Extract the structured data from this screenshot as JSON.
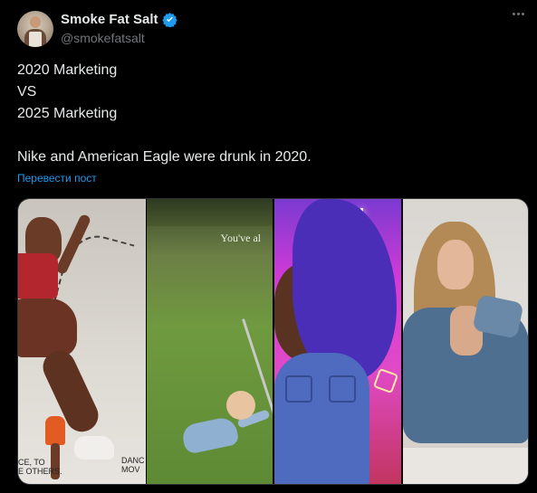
{
  "author": {
    "display_name": "Smoke Fat Salt",
    "handle": "@smokefatsalt",
    "verified": true
  },
  "tweet": {
    "lines": [
      "2020 Marketing",
      "VS",
      "2025 Marketing",
      "",
      "Nike and American Eagle were drunk in 2020."
    ],
    "translate_label": "Перевести пост"
  },
  "media": {
    "panels": [
      {
        "caption_left": "CE, TO\nE OTHERS.",
        "caption_right": "DANC\nMOV"
      },
      {
        "overlay_text": "You've al"
      },
      {},
      {}
    ]
  },
  "icons": {
    "more": "more-horizontal-icon",
    "verified": "verified-badge-icon"
  },
  "colors": {
    "background": "#000000",
    "text": "#e7e9ea",
    "secondary_text": "#71767b",
    "link": "#1d9bf0",
    "verified": "#1d9bf0"
  }
}
